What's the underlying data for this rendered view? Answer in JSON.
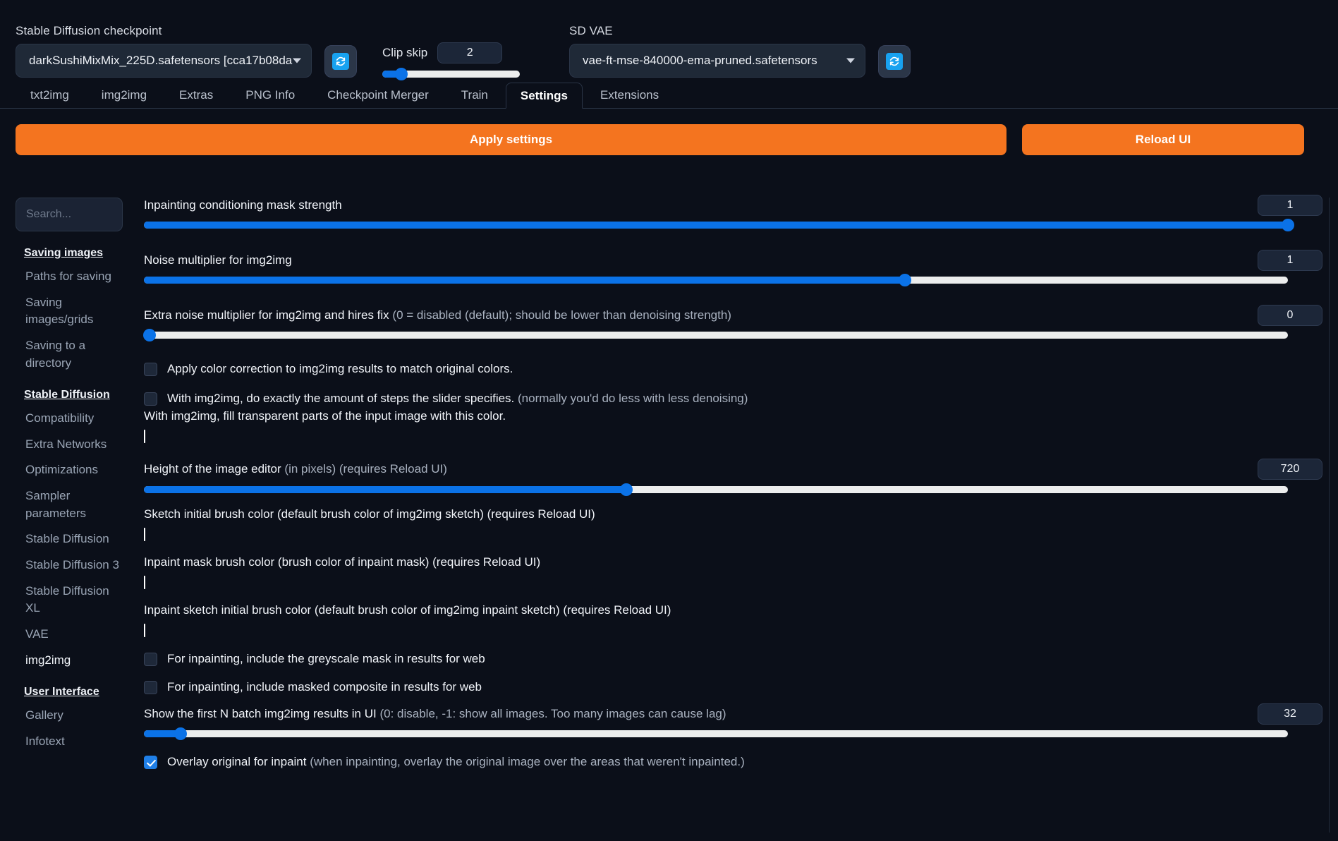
{
  "topbar": {
    "checkpoint": {
      "label": "Stable Diffusion checkpoint",
      "value": "darkSushiMixMix_225D.safetensors [cca17b08da",
      "refresh_icon": "refresh-icon"
    },
    "clip_skip": {
      "label": "Clip skip",
      "value": "2",
      "percent": 14
    },
    "vae": {
      "label": "SD VAE",
      "value": "vae-ft-mse-840000-ema-pruned.safetensors",
      "refresh_icon": "refresh-icon"
    }
  },
  "tabs": [
    {
      "label": "txt2img",
      "active": false
    },
    {
      "label": "img2img",
      "active": false
    },
    {
      "label": "Extras",
      "active": false
    },
    {
      "label": "PNG Info",
      "active": false
    },
    {
      "label": "Checkpoint Merger",
      "active": false
    },
    {
      "label": "Train",
      "active": false
    },
    {
      "label": "Settings",
      "active": true
    },
    {
      "label": "Extensions",
      "active": false
    }
  ],
  "actions": {
    "apply_label": "Apply settings",
    "reload_label": "Reload UI",
    "accent_color": "#f4741f"
  },
  "sidebar": {
    "search_placeholder": "Search...",
    "groups": [
      {
        "heading": "Saving images",
        "items": [
          {
            "label": "Paths for saving",
            "current": false
          },
          {
            "label": "Saving images/grids",
            "current": false
          },
          {
            "label": "Saving to a directory",
            "current": false
          }
        ]
      },
      {
        "heading": "Stable Diffusion",
        "items": [
          {
            "label": "Compatibility",
            "current": false
          },
          {
            "label": "Extra Networks",
            "current": false
          },
          {
            "label": "Optimizations",
            "current": false
          },
          {
            "label": "Sampler parameters",
            "current": false
          },
          {
            "label": "Stable Diffusion",
            "current": false
          },
          {
            "label": "Stable Diffusion 3",
            "current": false
          },
          {
            "label": "Stable Diffusion XL",
            "current": false
          },
          {
            "label": "VAE",
            "current": false
          },
          {
            "label": "img2img",
            "current": true
          }
        ]
      },
      {
        "heading": "User Interface",
        "items": [
          {
            "label": "Gallery",
            "current": false
          },
          {
            "label": "Infotext",
            "current": false
          }
        ]
      }
    ]
  },
  "settings": {
    "sliders": {
      "inpaint_mask_strength": {
        "label": "Inpainting conditioning mask strength",
        "hint": "",
        "value": "1",
        "percent": 100
      },
      "noise_multiplier": {
        "label": "Noise multiplier for img2img",
        "hint": "",
        "value": "1",
        "percent": 66.5
      },
      "extra_noise_multiplier": {
        "label": "Extra noise multiplier for img2img and hires fix ",
        "hint": "(0 = disabled (default); should be lower than denoising strength)",
        "value": "0",
        "percent": 0
      },
      "editor_height": {
        "label": "Height of the image editor ",
        "hint": "(in pixels) (requires Reload UI)",
        "value": "720",
        "percent": 42.2
      },
      "batch_results": {
        "label": "Show the first N batch img2img results in UI ",
        "hint": "(0: disable, -1: show all images. Too many images can cause lag)",
        "value": "32",
        "percent": 3.2
      }
    },
    "checkboxes": {
      "color_correction": {
        "label": "Apply color correction to img2img results to match original colors.",
        "hint": "",
        "checked": false
      },
      "exact_steps": {
        "label": "With img2img, do exactly the amount of steps the slider specifies. ",
        "hint": "(normally you'd do less with less denoising)",
        "checked": false
      },
      "greyscale_mask": {
        "label": "For inpainting, include the greyscale mask in results for web",
        "hint": "",
        "checked": false
      },
      "masked_composite": {
        "label": "For inpainting, include masked composite in results for web",
        "hint": "",
        "checked": false
      },
      "overlay_original": {
        "label": "Overlay original for inpaint ",
        "hint": "(when inpainting, overlay the original image over the areas that weren't inpainted.)",
        "checked": true
      }
    },
    "colors": {
      "fill_transparent": {
        "label": "With img2img, fill transparent parts of the input image with this color.",
        "hint": "",
        "value": "#ffffff"
      },
      "sketch_brush": {
        "label": "Sketch initial brush color ",
        "hint": "(default brush color of img2img sketch) (requires Reload UI)",
        "value": "#ffffff"
      },
      "inpaint_mask_brush": {
        "label": "Inpaint mask brush color ",
        "hint": "(brush color of inpaint mask) (requires Reload UI)",
        "value": "#ffffff"
      },
      "inpaint_sketch_brush": {
        "label": "Inpaint sketch initial brush color ",
        "hint": "(default brush color of img2img inpaint sketch) (requires Reload UI)",
        "value": "#ffffff"
      }
    }
  }
}
